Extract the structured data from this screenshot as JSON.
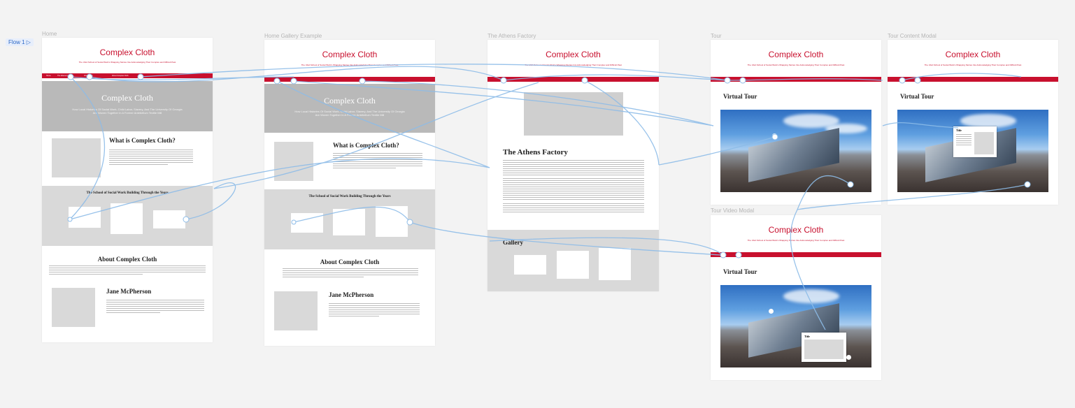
{
  "flow_label": "Flow 1",
  "frames": {
    "home": "Home",
    "home_gallery": "Home Gallery Example",
    "athens": "The Athens Factory",
    "tour": "Tour",
    "tour_content_modal": "Tour Content Modal",
    "tour_video_modal": "Tour Video Modal"
  },
  "site": {
    "brand": "Complex Cloth",
    "tagline": "The UGA School of Social Work's Wrapping Stories Into Acknowledging Their Complex and Difficult Past",
    "nav": [
      "Home",
      "The Athens Factory",
      "Virtual Tour",
      "About Complex Cloth"
    ],
    "hero_title": "Complex Cloth",
    "hero_subtitle": "How Local Histories Of Social Work, Child Labor, Slavery, And The University Of Georgia Are Woven Together In A Former Antebellum Textile Mill",
    "what_is": "What is Complex Cloth?",
    "school_building": "The School of Social Work Building Through the Years",
    "about": "About Complex Cloth",
    "person": "Jane McPherson",
    "athens_title": "The Athens Factory",
    "gallery": "Gallery",
    "virtual_tour": "Virtual Tour",
    "modal_title": "Title"
  }
}
